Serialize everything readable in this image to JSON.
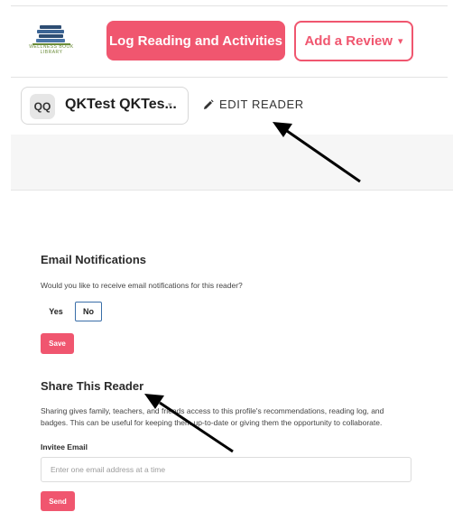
{
  "header": {
    "logo_text": "WELLNESS BOOK LIBRARY",
    "log_button": "Log Reading and Activities",
    "review_button": "Add a Review",
    "review_caret": "▾"
  },
  "reader": {
    "avatar_initials": "QQ",
    "name": "QKTest QKTes...",
    "caret": "▾",
    "edit_label": "EDIT READER"
  },
  "email_notifications": {
    "title": "Email Notifications",
    "question": "Would you like to receive email notifications for this reader?",
    "options": [
      "Yes",
      "No"
    ],
    "selected": "No",
    "save_button": "Save"
  },
  "share": {
    "title": "Share This Reader",
    "description": "Sharing gives family, teachers, and friends access to this profile's recommendations, reading log, and badges. This can be useful for keeping them up-to-date or giving them the opportunity to collaborate.",
    "invitee_label": "Invitee Email",
    "invitee_placeholder": "Enter one email address at a time",
    "send_button": "Send"
  },
  "colors": {
    "accent": "#f0566f",
    "selected_border": "#3a6ea8"
  }
}
